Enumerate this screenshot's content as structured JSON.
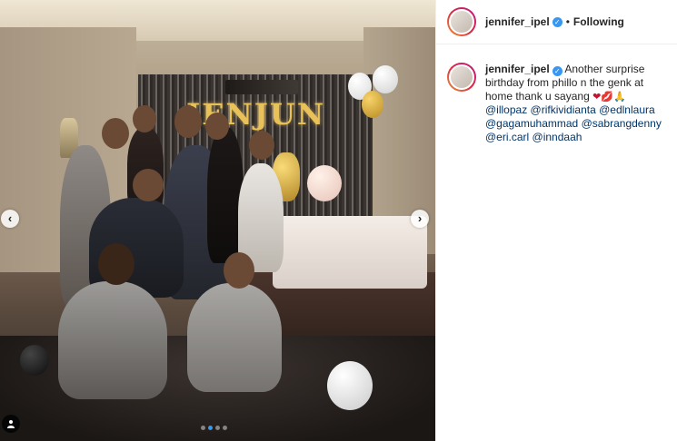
{
  "post": {
    "photo": {
      "balloon_text": "JENJUN",
      "carousel_dots": 4,
      "active_dot": 1
    }
  },
  "header": {
    "username": "jennifer_ipel",
    "separator": "•",
    "follow_label": "Following"
  },
  "caption": {
    "username": "jennifer_ipel",
    "text": "Another surprise birthday from phillo n the genk at home thank u sayang",
    "emojis": "❤💋🙏",
    "mentions": [
      "@illopaz",
      "@rifkividianta",
      "@edlnlaura",
      "@gagamuhammad",
      "@sabrangdenny",
      "@eri.carl",
      "@inndaah"
    ]
  },
  "colors": {
    "verified": "#3897f0",
    "mention": "#003569",
    "avatar_ring": "#dc2743"
  },
  "icons": {
    "prev": "chevron-left-icon",
    "next": "chevron-right-icon",
    "tags": "user-tag-icon",
    "verified": "verified-badge-icon"
  }
}
